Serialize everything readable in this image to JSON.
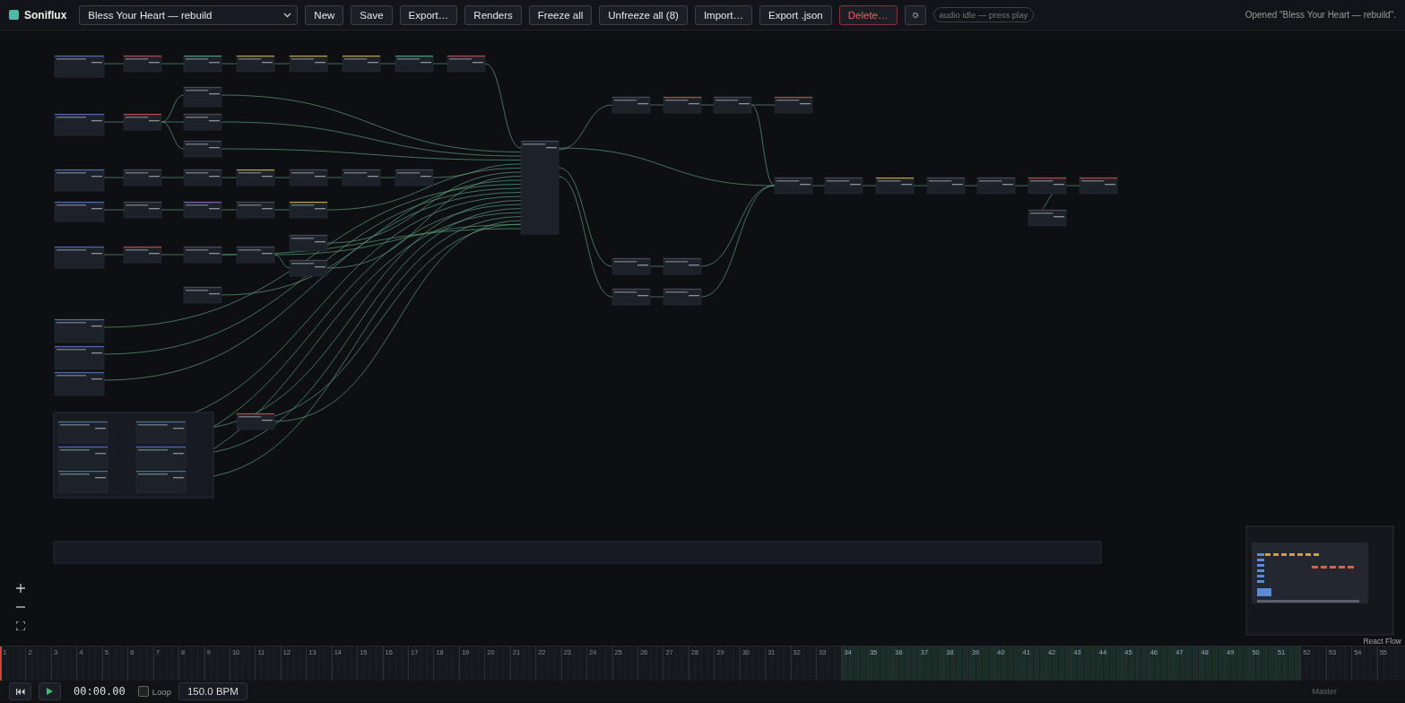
{
  "toolbar": {
    "app_name": "Soniflux",
    "project": {
      "value": "Bless Your Heart — rebuild"
    },
    "buttons": [
      {
        "label": "New",
        "kind": "normal"
      },
      {
        "label": "Save",
        "kind": "normal"
      },
      {
        "label": "Export…",
        "kind": "normal"
      },
      {
        "label": "Renders",
        "kind": "normal"
      },
      {
        "label": "Freeze all",
        "kind": "normal"
      },
      {
        "label": "Unfreeze all (8)",
        "kind": "normal"
      },
      {
        "label": "Import…",
        "kind": "normal"
      },
      {
        "label": "Export .json",
        "kind": "normal"
      },
      {
        "label": "Delete…",
        "kind": "danger"
      }
    ],
    "audio_status": "audio idle — press play",
    "message": "Opened \"Bless Your Heart — rebuild\"."
  },
  "canvas": {
    "attribution": "React Flow"
  },
  "timeline": {
    "bars": [
      {
        "label": "1",
        "selected": false
      },
      {
        "label": "2",
        "selected": false
      },
      {
        "label": "3",
        "selected": false
      },
      {
        "label": "4",
        "selected": false
      },
      {
        "label": "5",
        "selected": false
      },
      {
        "label": "6",
        "selected": false
      },
      {
        "label": "7",
        "selected": false
      },
      {
        "label": "8",
        "selected": false
      },
      {
        "label": "9",
        "selected": false
      },
      {
        "label": "10",
        "selected": false
      },
      {
        "label": "11",
        "selected": false
      },
      {
        "label": "12",
        "selected": false
      },
      {
        "label": "13",
        "selected": false
      },
      {
        "label": "14",
        "selected": false
      },
      {
        "label": "15",
        "selected": false
      },
      {
        "label": "16",
        "selected": false
      },
      {
        "label": "17",
        "selected": false
      },
      {
        "label": "18",
        "selected": false
      },
      {
        "label": "19",
        "selected": false
      },
      {
        "label": "20",
        "selected": false
      },
      {
        "label": "21",
        "selected": false
      },
      {
        "label": "22",
        "selected": false
      },
      {
        "label": "23",
        "selected": false
      },
      {
        "label": "24",
        "selected": false
      },
      {
        "label": "25",
        "selected": false
      },
      {
        "label": "26",
        "selected": false
      },
      {
        "label": "27",
        "selected": false
      },
      {
        "label": "28",
        "selected": false
      },
      {
        "label": "29",
        "selected": false
      },
      {
        "label": "30",
        "selected": false
      },
      {
        "label": "31",
        "selected": false
      },
      {
        "label": "32",
        "selected": false
      },
      {
        "label": "33",
        "selected": false
      },
      {
        "label": "34",
        "selected": true
      },
      {
        "label": "35",
        "selected": true
      },
      {
        "label": "36",
        "selected": true
      },
      {
        "label": "37",
        "selected": true
      },
      {
        "label": "38",
        "selected": true
      },
      {
        "label": "39",
        "selected": true
      },
      {
        "label": "40",
        "selected": true
      },
      {
        "label": "41",
        "selected": true
      },
      {
        "label": "42",
        "selected": true
      },
      {
        "label": "43",
        "selected": true
      },
      {
        "label": "44",
        "selected": true
      },
      {
        "label": "45",
        "selected": true
      },
      {
        "label": "46",
        "selected": true
      },
      {
        "label": "47",
        "selected": true
      },
      {
        "label": "48",
        "selected": true
      },
      {
        "label": "49",
        "selected": true
      },
      {
        "label": "50",
        "selected": true
      },
      {
        "label": "51",
        "selected": true
      },
      {
        "label": "52",
        "selected": false
      },
      {
        "label": "53",
        "selected": false
      },
      {
        "label": "54",
        "selected": false
      },
      {
        "label": "55",
        "selected": false
      }
    ]
  },
  "transport": {
    "time": "00:00.00",
    "loop": {
      "label": "Loop",
      "checked": false
    },
    "tempo": "150.0 BPM",
    "bus": "Master"
  }
}
